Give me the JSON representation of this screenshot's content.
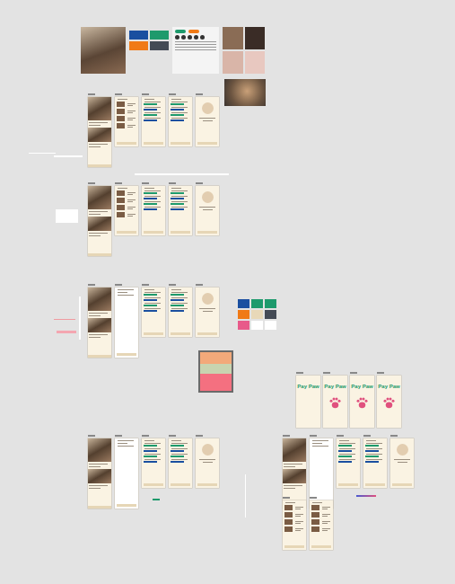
{
  "canvas": {
    "moodboard": {
      "swatches": [
        "#1a4fa0",
        "#1d9a6c",
        "#f07a16",
        "#444a55"
      ],
      "chips": [
        "#1d9a6c",
        "#f07a16"
      ]
    },
    "sections": [
      {
        "screens": [
          {
            "kind": "feed"
          },
          {
            "kind": "list"
          },
          {
            "kind": "form"
          },
          {
            "kind": "form"
          },
          {
            "kind": "profile"
          }
        ]
      },
      {
        "screens": [
          {
            "kind": "feed"
          },
          {
            "kind": "list"
          },
          {
            "kind": "form"
          },
          {
            "kind": "form"
          },
          {
            "kind": "profile"
          }
        ]
      },
      {
        "screens": [
          {
            "kind": "feed"
          },
          {
            "kind": "menu"
          },
          {
            "kind": "form"
          },
          {
            "kind": "form"
          },
          {
            "kind": "profile"
          }
        ]
      },
      {
        "screens": [
          {
            "kind": "feed"
          },
          {
            "kind": "menu"
          },
          {
            "kind": "form"
          },
          {
            "kind": "form"
          },
          {
            "kind": "profile"
          }
        ]
      },
      {
        "screens": [
          {
            "kind": "feed"
          },
          {
            "kind": "menu"
          },
          {
            "kind": "form"
          },
          {
            "kind": "form"
          },
          {
            "kind": "profile"
          }
        ]
      },
      {
        "screens": [
          {
            "kind": "list"
          },
          {
            "kind": "list"
          }
        ]
      }
    ],
    "palette": [
      {
        "color": "#1a4fa0"
      },
      {
        "color": "#1d9a6c"
      },
      {
        "color": "#1d9a6c"
      },
      {
        "color": "#f07a16"
      },
      {
        "color": "#e8d8b8"
      },
      {
        "color": "#444a55"
      },
      {
        "color": "#e85a8a"
      },
      {
        "color": "#ffffff"
      },
      {
        "color": "#ffffff"
      }
    ],
    "splash": [
      {
        "title": "Pay Paw"
      },
      {
        "title": "Pay Paw"
      },
      {
        "title": "Pay Paw"
      },
      {
        "title": "Pay Paw"
      }
    ]
  }
}
